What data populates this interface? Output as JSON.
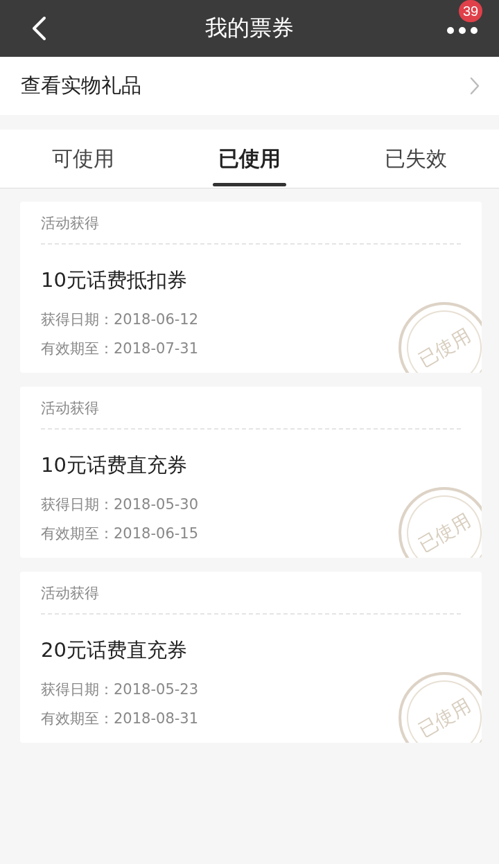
{
  "header": {
    "title": "我的票券",
    "badge": "39"
  },
  "gift_link": {
    "label": "查看实物礼品"
  },
  "tabs": [
    {
      "label": "可使用",
      "selected": false
    },
    {
      "label": "已使用",
      "selected": true
    },
    {
      "label": "已失效",
      "selected": false
    }
  ],
  "coupons": [
    {
      "source": "活动获得",
      "name": "10元话费抵扣券",
      "obtained": "获得日期：2018-06-12",
      "valid_until": "有效期至：2018-07-31",
      "stamp": "已使用"
    },
    {
      "source": "活动获得",
      "name": "10元话费直充券",
      "obtained": "获得日期：2018-05-30",
      "valid_until": "有效期至：2018-06-15",
      "stamp": "已使用"
    },
    {
      "source": "活动获得",
      "name": "20元话费直充券",
      "obtained": "获得日期：2018-05-23",
      "valid_until": "有效期至：2018-08-31",
      "stamp": "已使用"
    }
  ]
}
